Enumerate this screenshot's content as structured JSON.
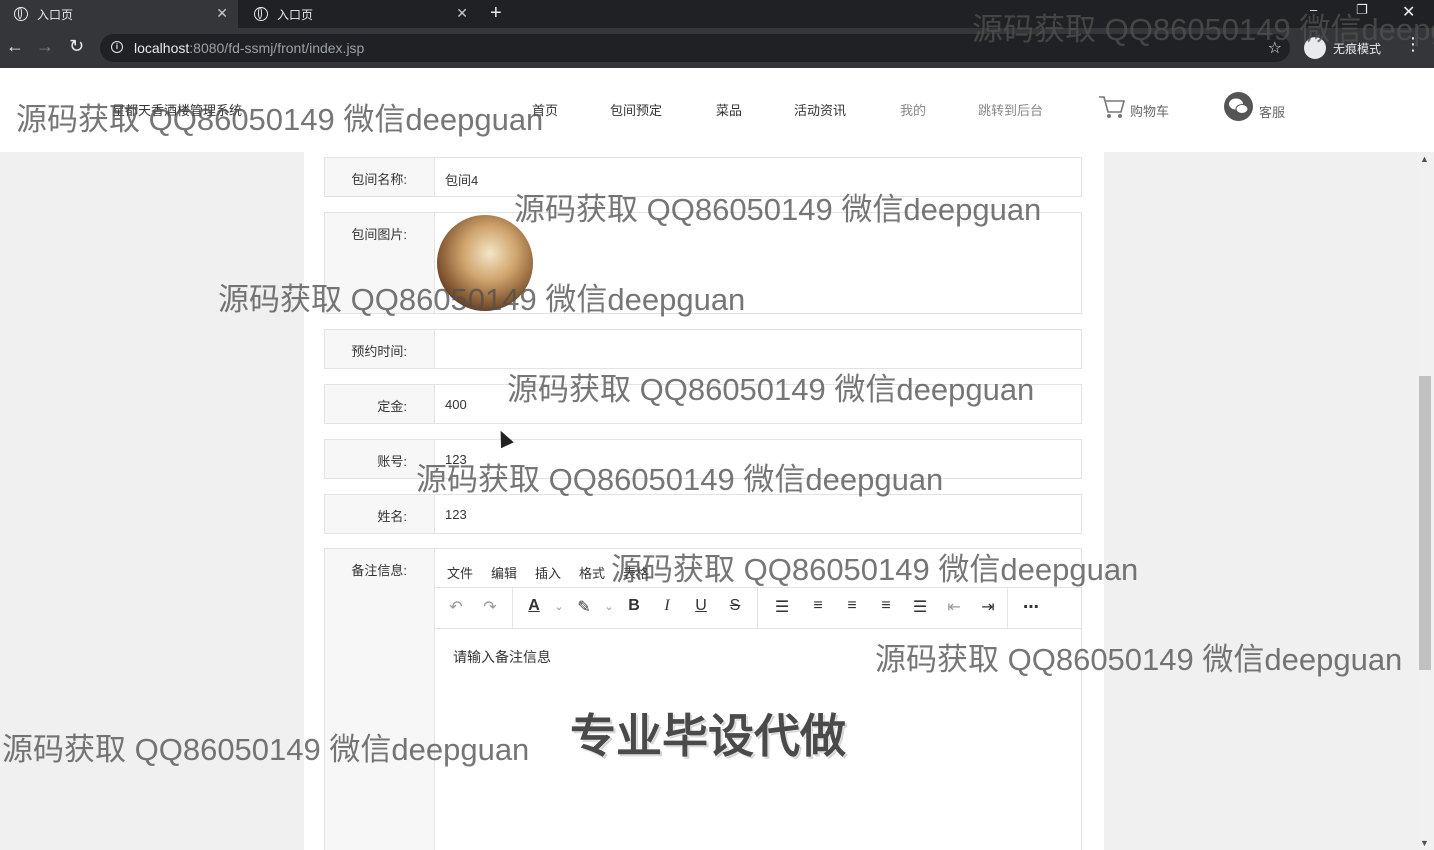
{
  "browser": {
    "tabs": [
      {
        "title": "入口页",
        "active": true
      },
      {
        "title": "入口页",
        "active": false
      }
    ],
    "url_host": "localhost",
    "url_rest": ":8080/fd-ssmj/front/index.jsp",
    "incognito_label": "无痕模式"
  },
  "header": {
    "site_title": "星都天香酒楼管理系统",
    "nav": [
      "首页",
      "包间预定",
      "菜品",
      "活动资讯",
      "我的",
      "跳转到后台"
    ],
    "cart_label": "购物车",
    "service_label": "客服"
  },
  "form": {
    "room_name_label": "包间名称:",
    "room_name_value": "包间4",
    "room_image_label": "包间图片:",
    "reserve_time_label": "预约时间:",
    "reserve_time_value": "",
    "deposit_label": "定金:",
    "deposit_value": "400",
    "account_label": "账号:",
    "account_value": "123",
    "name_label": "姓名:",
    "name_value": "123",
    "remark_label": "备注信息:"
  },
  "editor": {
    "menus": [
      "文件",
      "编辑",
      "插入",
      "格式",
      "表格"
    ],
    "placeholder": "请输入备注信息",
    "tools": [
      "undo-icon",
      "redo-icon",
      "font-color-icon",
      "highlight-icon",
      "bold-icon",
      "italic-icon",
      "underline-icon",
      "strikethrough-icon",
      "line-height-icon",
      "align-left-icon",
      "align-center-icon",
      "align-right-icon",
      "justify-icon",
      "outdent-icon",
      "indent-icon",
      "more-icon"
    ]
  },
  "watermark": {
    "text": "源码获取 QQ86050149 微信deepguan",
    "big_text": "专业毕设代做"
  }
}
